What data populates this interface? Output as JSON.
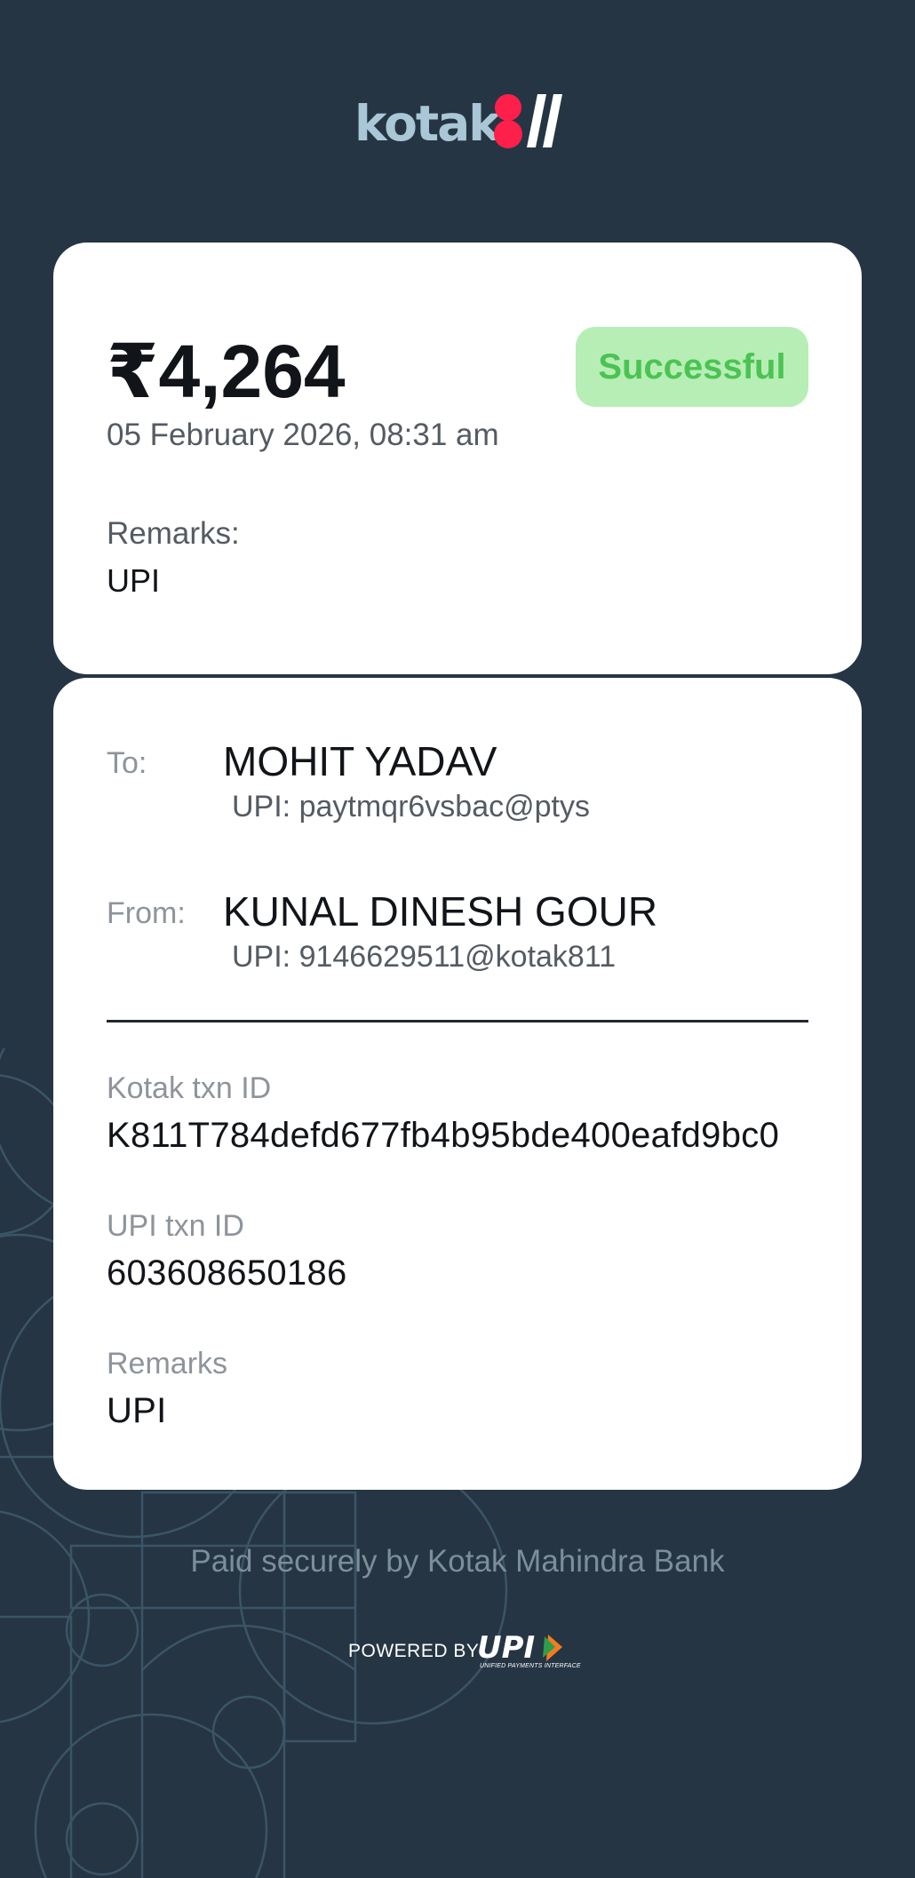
{
  "brand": {
    "logo_text": "kotak",
    "logo_accent": "#ff1f4b",
    "logo_text_color": "#a9c7d6"
  },
  "summary": {
    "amount": "₹4,264",
    "datetime": "05 February 2026, 08:31 am",
    "status": "Successful",
    "remarks_label": "Remarks:",
    "remarks_value": "UPI"
  },
  "details": {
    "to_label": "To:",
    "to_name": "MOHIT YADAV",
    "to_upi": "UPI: paytmqr6vsbac@ptys",
    "from_label": "From:",
    "from_name": "KUNAL DINESH GOUR",
    "from_upi": "UPI: 9146629511@kotak811",
    "kotak_txn_label": "Kotak txn ID",
    "kotak_txn_value": "K811T784defd677fb4b95bde400eafd9bc0",
    "upi_txn_label": "UPI txn ID",
    "upi_txn_value": "603608650186",
    "remarks_label": "Remarks",
    "remarks_value": "UPI"
  },
  "footer": {
    "paid_text": "Paid securely by Kotak Mahindra Bank",
    "powered_by": "POWERED BY",
    "upi_logo_text": "UPI",
    "upi_tagline": "UNIFIED PAYMENTS INTERFACE"
  },
  "colors": {
    "background": "#263543",
    "success_bg": "#b7eeb5",
    "success_text": "#4bc353"
  },
  "icons": [
    "kotak-logo-icon",
    "upi-logo-icon",
    "background-pattern"
  ]
}
